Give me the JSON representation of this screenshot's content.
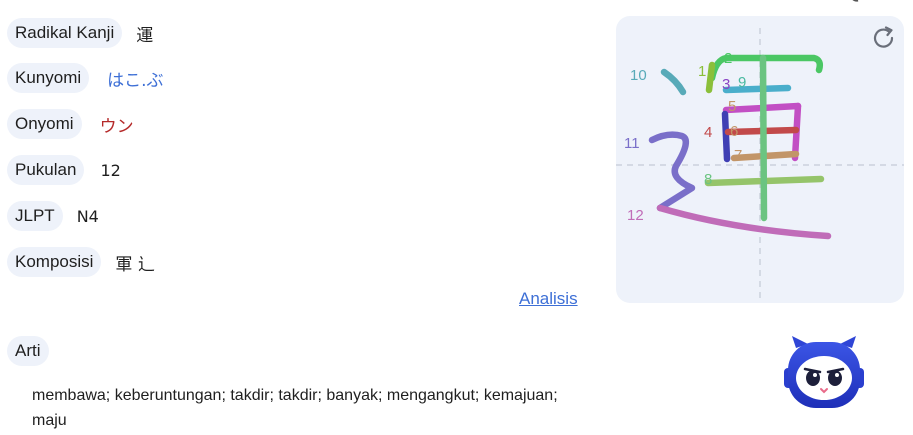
{
  "info": {
    "radikal": {
      "label": "Radikal Kanji",
      "value": "運"
    },
    "kunyomi": {
      "label": "Kunyomi",
      "value": "はこ.ぶ"
    },
    "onyomi": {
      "label": "Onyomi",
      "value": "ウン"
    },
    "pukulan": {
      "label": "Pukulan",
      "value": "12"
    },
    "jlpt": {
      "label": "JLPT",
      "value": "N4"
    },
    "komposisi": {
      "label": "Komposisi",
      "value": "軍 辶"
    }
  },
  "analisis_link": "Analisis",
  "arti": {
    "label": "Arti",
    "text": "membawa; keberuntungan; takdir; takdir; banyak; mengangkut; kemajuan; maju"
  },
  "stroke_panel": {
    "stroke_numbers": [
      "1",
      "2",
      "3",
      "9",
      "5",
      "4",
      "6",
      "7",
      "8",
      "10",
      "11",
      "12"
    ],
    "refresh_icon": "refresh-icon"
  },
  "colors": {
    "pill_bg": "#eef2fa",
    "link": "#3d6fd6",
    "onyomi": "#b52a2a",
    "panel_bg": "#eef2fa"
  }
}
